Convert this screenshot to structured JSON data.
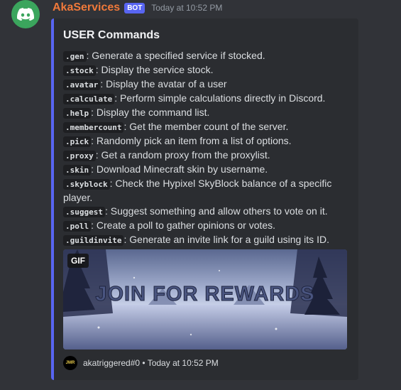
{
  "message": {
    "author": "AkaServices",
    "badge": "BOT",
    "timestamp": "Today at 10:52 PM",
    "avatar_icon": "discord-logo-icon"
  },
  "embed": {
    "accent_color": "#5865f2",
    "title": "USER Commands",
    "commands": [
      {
        "cmd": ".gen",
        "desc": ": Generate a specified service if stocked."
      },
      {
        "cmd": ".stock",
        "desc": ": Display the service stock."
      },
      {
        "cmd": ".avatar",
        "desc": ": Display the avatar of a user"
      },
      {
        "cmd": ".calculate",
        "desc": ": Perform simple calculations directly in Discord."
      },
      {
        "cmd": ".help",
        "desc": ": Display the command list."
      },
      {
        "cmd": ".membercount",
        "desc": ": Get the member count of the server."
      },
      {
        "cmd": ".pick",
        "desc": ": Randomly pick an item from a list of options."
      },
      {
        "cmd": ".proxy",
        "desc": ": Get a random proxy from the proxylist."
      },
      {
        "cmd": ".skin",
        "desc": ": Download Minecraft skin by username."
      },
      {
        "cmd": ".skyblock",
        "desc": ": Check the Hypixel SkyBlock balance of a specific player."
      },
      {
        "cmd": ".suggest",
        "desc": ": Suggest something and allow others to vote on it."
      },
      {
        "cmd": ".poll",
        "desc": ": Create a poll to gather opinions or votes."
      },
      {
        "cmd": ".guildinvite",
        "desc": ": Generate an invite link for a guild using its ID."
      }
    ],
    "image": {
      "badge": "GIF",
      "text": "JOIN FOR REWARDS"
    },
    "footer": {
      "icon_text": "JMR",
      "text": "akatriggered#0 • Today at 10:52 PM"
    }
  }
}
